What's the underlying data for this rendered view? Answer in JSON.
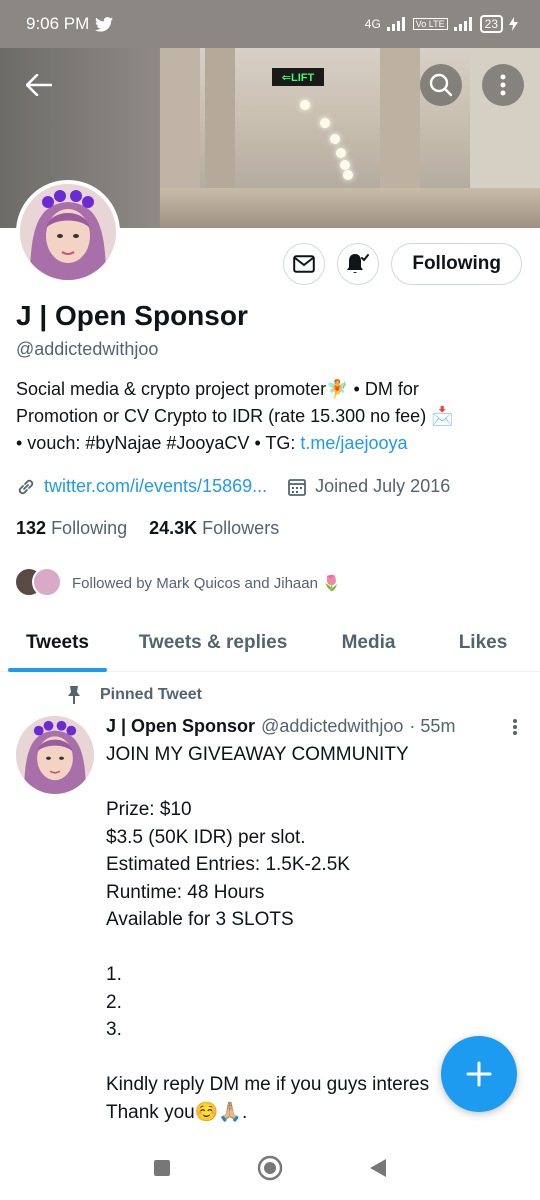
{
  "status_bar": {
    "time": "9:06 PM",
    "network_1": "4G",
    "volte": "Vo LTE",
    "battery": "23"
  },
  "banner": {
    "exit_sign": "⇐LIFT"
  },
  "header_icons": {
    "back": "back-arrow-icon",
    "search": "search-icon",
    "more": "more-vertical-icon"
  },
  "profile": {
    "display_name": "J | Open Sponsor",
    "handle": "@addictedwithjoo",
    "bio_line1": "Social media & crypto project promoter🧚 • DM for",
    "bio_line2": "Promotion or CV Crypto to IDR (rate 15.300 no fee) 📩",
    "bio_line3_prefix": "• vouch: #byNajae #JooyaCV • TG: ",
    "bio_link": "t.me/jaejooya",
    "website": "twitter.com/i/events/15869...",
    "joined": "Joined July 2016",
    "following_count": "132",
    "following_label": "Following",
    "followers_count": "24.3K",
    "followers_label": "Followers",
    "followed_by": "Followed by Mark Quicos and Jihaan 🌷",
    "following_button": "Following"
  },
  "tabs": [
    {
      "label": "Tweets",
      "active": true
    },
    {
      "label": "Tweets & replies",
      "active": false
    },
    {
      "label": "Media",
      "active": false
    },
    {
      "label": "Likes",
      "active": false
    }
  ],
  "pinned_tweet": {
    "pinned_label": "Pinned Tweet",
    "author_name": "J | Open Sponsor",
    "author_handle": "@addictedwithjoo",
    "time": "· 55m",
    "lines": [
      "JOIN MY GIVEAWAY COMMUNITY",
      "",
      "Prize: $10",
      "$3.5 (50K IDR) per slot.",
      "Estimated Entries: 1.5K-2.5K",
      "Runtime: 48 Hours",
      "Available for 3 SLOTS",
      "",
      "1.",
      "2.",
      "3.",
      "",
      "Kindly reply DM me if you guys interes",
      "Thank you☺️🙏🏼."
    ]
  },
  "colors": {
    "accent": "#1d9bf0",
    "text_primary": "#0f1419",
    "text_secondary": "#536471",
    "status_bar": "#8b8782"
  }
}
